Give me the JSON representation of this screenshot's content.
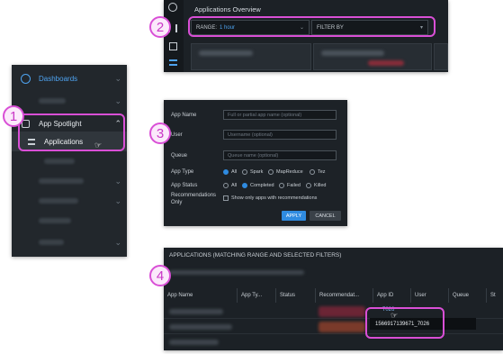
{
  "callouts": [
    "1",
    "2",
    "3",
    "4"
  ],
  "sidebar": {
    "dashboards_label": "Dashboards",
    "app_spotlight_label": "App Spotlight",
    "applications_label": "Applications"
  },
  "overview": {
    "title": "Applications Overview",
    "range_label": "RANGE:",
    "range_value": "1 hour",
    "filter_by_label": "FILTER BY"
  },
  "filter_form": {
    "app_name_label": "App Name",
    "app_name_placeholder": "Full or partial app name (optional)",
    "user_label": "User",
    "user_placeholder": "Username (optional)",
    "queue_label": "Queue",
    "queue_placeholder": "Queue name (optional)",
    "app_type_label": "App Type",
    "app_type_options": [
      "All",
      "Spark",
      "MapReduce",
      "Tez"
    ],
    "app_status_label": "App Status",
    "app_status_options": [
      "All",
      "Completed",
      "Failed",
      "Killed"
    ],
    "recommendations_label_1": "Recommendations",
    "recommendations_label_2": "Only",
    "recommendations_checkbox": "Show only apps with recommendations",
    "apply_label": "APPLY",
    "cancel_label": "CANCEL"
  },
  "apps_table": {
    "title": "APPLICATIONS (MATCHING RANGE AND SELECTED FILTERS)",
    "columns": [
      "App Name",
      "App Ty...",
      "Status",
      "Recommendat...",
      "App ID",
      "User",
      "Queue",
      "St"
    ],
    "app_id_short": "7026",
    "app_id_tooltip": "1566917139671_7026"
  },
  "colors": {
    "accent": "#2f8be0",
    "callout": "#d94fd6",
    "panel_bg": "#1f2429"
  }
}
